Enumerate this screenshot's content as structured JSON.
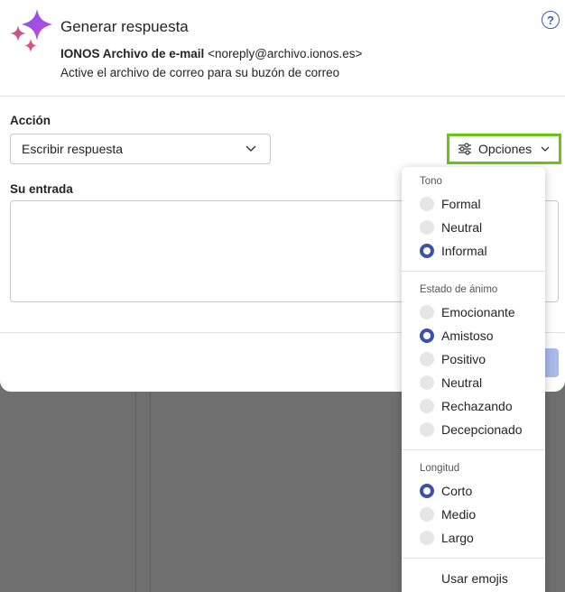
{
  "dialog": {
    "title": "Generar respuesta",
    "sender_name": "IONOS Archivo de e-mail",
    "sender_email": "<noreply@archivo.ionos.es>",
    "subject": "Active el archivo de correo para su buzón de correo",
    "help_icon": "?"
  },
  "form": {
    "action_label": "Acción",
    "action_value": "Escribir respuesta",
    "input_label": "Su entrada",
    "input_value": "",
    "options_label": "Opciones"
  },
  "menu": {
    "tone": {
      "title": "Tono",
      "options": [
        "Formal",
        "Neutral",
        "Informal"
      ],
      "selected": "Informal"
    },
    "mood": {
      "title": "Estado de ánimo",
      "options": [
        "Emocionante",
        "Amistoso",
        "Positivo",
        "Neutral",
        "Rechazando",
        "Decepcionado"
      ],
      "selected": "Amistoso"
    },
    "length": {
      "title": "Longitud",
      "options": [
        "Corto",
        "Medio",
        "Largo"
      ],
      "selected": "Corto"
    },
    "emoji_label": "Usar emojis"
  },
  "colors": {
    "accent": "#3b52a8",
    "highlight_border": "#6cc417",
    "primary_disabled": "#a9b9e8"
  },
  "icons": {
    "app": "copilot-sparkle-icon",
    "help": "help-icon",
    "dropdown": "chevron-down-icon",
    "options": "sliders-icon"
  }
}
